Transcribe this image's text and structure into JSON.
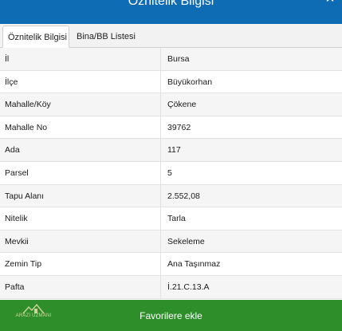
{
  "window": {
    "title": "Öznitelik Bilgisi",
    "close_glyph": "✕",
    "accent_color": "#0e6cb4"
  },
  "tabs": [
    {
      "label": "Öznitelik Bilgisi",
      "active": true
    },
    {
      "label": "Bina/BB Listesi",
      "active": false
    }
  ],
  "attributes": [
    {
      "key": "İl",
      "value": "Bursa"
    },
    {
      "key": "İlçe",
      "value": "Büyükorhan"
    },
    {
      "key": "Mahalle/Köy",
      "value": "Çökene"
    },
    {
      "key": "Mahalle No",
      "value": "39762"
    },
    {
      "key": "Ada",
      "value": "117"
    },
    {
      "key": "Parsel",
      "value": "5"
    },
    {
      "key": "Tapu Alanı",
      "value": "2.552,08"
    },
    {
      "key": "Nitelik",
      "value": "Tarla"
    },
    {
      "key": "Mevkii",
      "value": "Sekeleme"
    },
    {
      "key": "Zemin Tip",
      "value": "Ana Taşınmaz"
    },
    {
      "key": "Pafta",
      "value": "İ.21.C.13.A"
    }
  ],
  "footer": {
    "button_label": "Favorilere ekle",
    "button_color": "#2e8f2a",
    "logo_text": "ARAZİ UZMANI",
    "logo_icon": "building-logo-icon"
  }
}
